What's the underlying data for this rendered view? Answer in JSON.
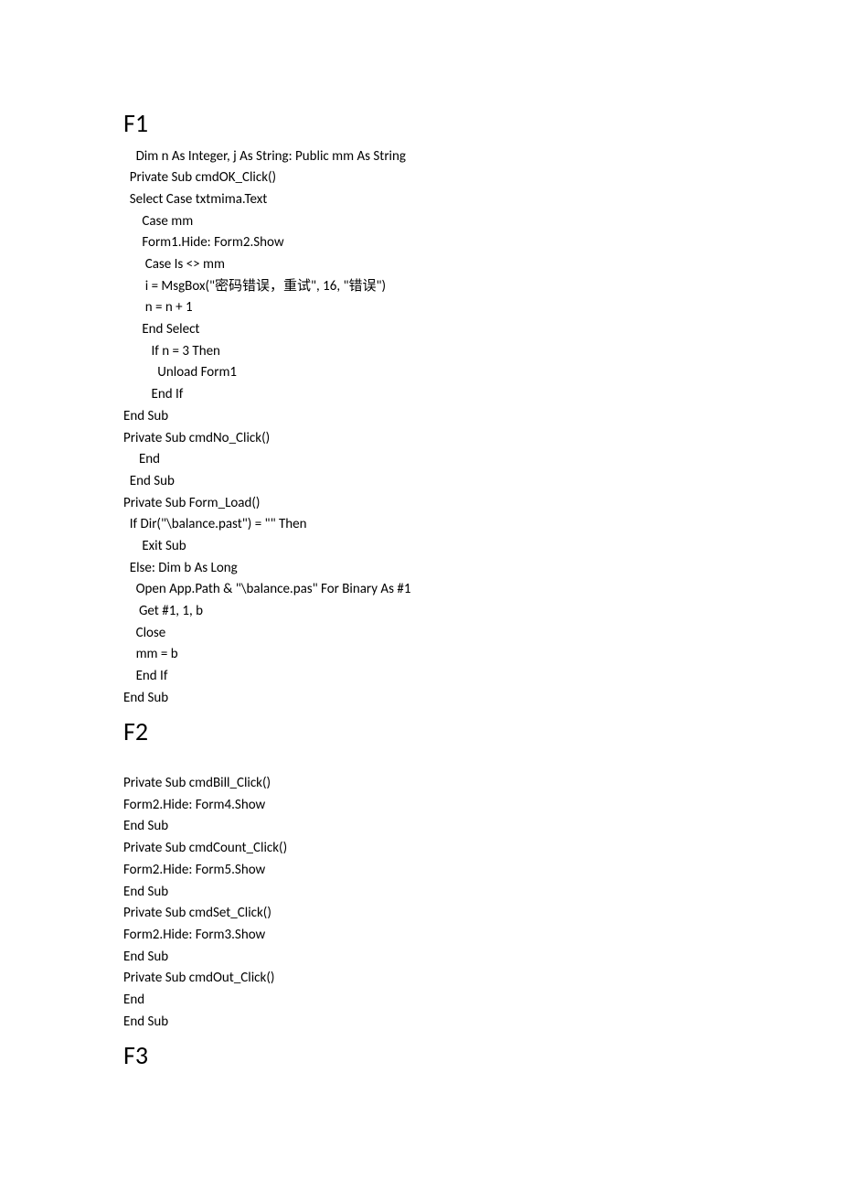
{
  "sections": {
    "f1": {
      "heading": "F1",
      "lines": [
        "    Dim n As Integer, j As String: Public mm As String",
        "  Private Sub cmdOK_Click()",
        "  Select Case txtmima.Text",
        "      Case mm",
        "      Form1.Hide: Form2.Show",
        "       Case Is <> mm",
        "       i = MsgBox(\"密码错误，重试\", 16, \"错误\")",
        "       n = n + 1",
        "      End Select",
        "         If n = 3 Then",
        "           Unload Form1",
        "         End If",
        "End Sub",
        "Private Sub cmdNo_Click()",
        "     End",
        "  End Sub",
        "Private Sub Form_Load()",
        "  If Dir(\"\\balance.past\") = \"\" Then",
        "      Exit Sub",
        "  Else: Dim b As Long",
        "    Open App.Path & \"\\balance.pas\" For Binary As #1",
        "     Get #1, 1, b",
        "    Close",
        "    mm = b",
        "    End If",
        "End Sub"
      ]
    },
    "f2": {
      "heading": "F2",
      "lines": [
        "Private Sub cmdBill_Click()",
        "Form2.Hide: Form4.Show",
        "End Sub",
        "Private Sub cmdCount_Click()",
        "Form2.Hide: Form5.Show",
        "End Sub",
        "Private Sub cmdSet_Click()",
        "Form2.Hide: Form3.Show",
        "End Sub",
        "Private Sub cmdOut_Click()",
        "End",
        "End Sub"
      ]
    },
    "f3": {
      "heading": "F3"
    }
  }
}
